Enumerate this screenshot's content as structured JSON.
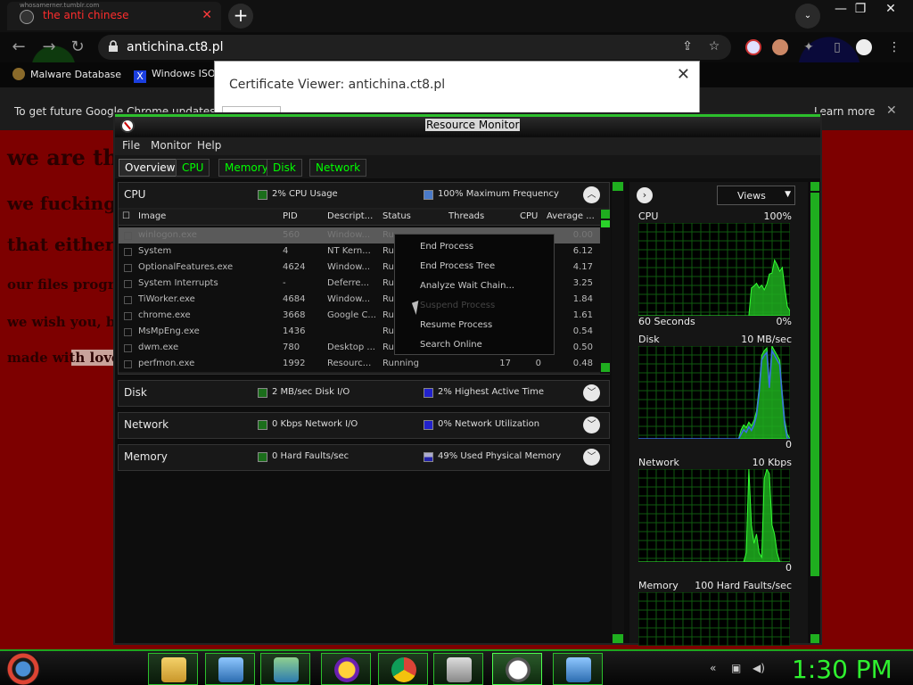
{
  "browser": {
    "tab": {
      "title": "the anti chinese",
      "url_caption": "whosamerner.tumblr.com"
    },
    "url": "antichina.ct8.pl",
    "bookmarks": [
      "Malware Database",
      "Windows ISO"
    ],
    "infobar": {
      "message": "To get future Google Chrome updates,",
      "learn_more": "Learn more"
    },
    "page_lines": [
      "we are th",
      "we fucking",
      "that either",
      "our files progr",
      "we wish you, b",
      "made with love"
    ],
    "cert_viewer": {
      "title": "Certificate Viewer: antichina.ct8.pl"
    }
  },
  "resmon": {
    "title": "Resource Monitor",
    "menu": [
      "File",
      "Monitor",
      "Help"
    ],
    "tabs": [
      "Overview",
      "CPU",
      "Memory",
      "Disk",
      "Network"
    ],
    "cpu": {
      "name": "CPU",
      "usage": "2% CPU Usage",
      "freq": "100% Maximum Frequency",
      "columns": [
        "Image",
        "PID",
        "Descript...",
        "Status",
        "Threads",
        "CPU",
        "Average ..."
      ],
      "rows": [
        {
          "image": "winlogon.exe",
          "pid": "560",
          "desc": "Window...",
          "status": "Ru...",
          "threads": "",
          "cpu": "",
          "avg": "0.00"
        },
        {
          "image": "System",
          "pid": "4",
          "desc": "NT Kern...",
          "status": "Ru...",
          "threads": "",
          "cpu": "",
          "avg": "6.12"
        },
        {
          "image": "OptionalFeatures.exe",
          "pid": "4624",
          "desc": "Window...",
          "status": "Ru...",
          "threads": "",
          "cpu": "",
          "avg": "4.17"
        },
        {
          "image": "System Interrupts",
          "pid": "-",
          "desc": "Deferre...",
          "status": "Ru...",
          "threads": "",
          "cpu": "",
          "avg": "3.25"
        },
        {
          "image": "TiWorker.exe",
          "pid": "4684",
          "desc": "Window...",
          "status": "Ru...",
          "threads": "",
          "cpu": "",
          "avg": "1.84"
        },
        {
          "image": "chrome.exe",
          "pid": "3668",
          "desc": "Google C...",
          "status": "Ru...",
          "threads": "",
          "cpu": "",
          "avg": "1.61"
        },
        {
          "image": "MsMpEng.exe",
          "pid": "1436",
          "desc": "",
          "status": "Ru...",
          "threads": "",
          "cpu": "",
          "avg": "0.54"
        },
        {
          "image": "dwm.exe",
          "pid": "780",
          "desc": "Desktop ...",
          "status": "Ru...",
          "threads": "",
          "cpu": "",
          "avg": "0.50"
        },
        {
          "image": "perfmon.exe",
          "pid": "1992",
          "desc": "Resourc...",
          "status": "Running",
          "threads": "17",
          "cpu": "0",
          "avg": "0.48"
        }
      ]
    },
    "context_menu": [
      "End Process",
      "End Process Tree",
      "Analyze Wait Chain...",
      "Suspend Process",
      "Resume Process",
      "Search Online"
    ],
    "disk": {
      "name": "Disk",
      "io": "2 MB/sec Disk I/O",
      "active": "2% Highest Active Time"
    },
    "network": {
      "name": "Network",
      "io": "0 Kbps Network I/O",
      "util": "0% Network Utilization"
    },
    "memory": {
      "name": "Memory",
      "faults": "0 Hard Faults/sec",
      "used": "49% Used Physical Memory"
    },
    "right": {
      "views": "Views",
      "graphs": [
        {
          "title": "CPU",
          "max": "100%",
          "foot": "60 Seconds",
          "zero": "0%",
          "levels": [
            0,
            0,
            0,
            0,
            0,
            0,
            0,
            0,
            0,
            0,
            0,
            0,
            0,
            0,
            0,
            0,
            0,
            0,
            0,
            0,
            0,
            0,
            0,
            0,
            0,
            0,
            0,
            0,
            0,
            0,
            0,
            0,
            0,
            0,
            0,
            0,
            0,
            0,
            0,
            0,
            0,
            0,
            0,
            0,
            0.3,
            0.32,
            0.35,
            0.3,
            0.33,
            0.28,
            0.34,
            0.45,
            0.46,
            0.6,
            0.55,
            0.48,
            0.52,
            0.3,
            0.1,
            0.05
          ]
        },
        {
          "title": "Disk",
          "max": "10 MB/sec",
          "foot": "",
          "zero": "0",
          "levels": [
            0,
            0,
            0,
            0,
            0,
            0,
            0,
            0,
            0,
            0,
            0,
            0,
            0,
            0,
            0,
            0,
            0,
            0,
            0,
            0,
            0,
            0,
            0,
            0,
            0,
            0,
            0,
            0,
            0,
            0,
            0,
            0,
            0,
            0,
            0,
            0,
            0,
            0,
            0,
            0,
            0.1,
            0.15,
            0.12,
            0.18,
            0.14,
            0.2,
            0.3,
            0.55,
            0.9,
            0.95,
            0.98,
            0.6,
            1.0,
            0.95,
            0.9,
            0.85,
            0.5,
            0.2,
            0.05,
            0.0
          ]
        },
        {
          "title": "Network",
          "max": "10 Kbps",
          "foot": "",
          "zero": "0",
          "levels": [
            0,
            0,
            0,
            0,
            0,
            0,
            0,
            0,
            0,
            0,
            0,
            0,
            0,
            0,
            0,
            0,
            0,
            0,
            0,
            0,
            0,
            0,
            0,
            0,
            0,
            0,
            0,
            0,
            0,
            0,
            0,
            0,
            0,
            0,
            0,
            0,
            0,
            0,
            0,
            0,
            0,
            0,
            0.1,
            1.0,
            0.4,
            0.2,
            0.3,
            0.1,
            0.05,
            0.9,
            1.0,
            0.95,
            0.4,
            0.3,
            0.1,
            0,
            0,
            0,
            0,
            0
          ]
        },
        {
          "title": "Memory",
          "max": "100 Hard Faults/sec",
          "foot": "",
          "zero": "",
          "levels": []
        }
      ]
    }
  },
  "taskbar": {
    "clock": "1:30 PM"
  },
  "colors": {
    "accent_green": "#1fae1f",
    "page_red": "#7d0000",
    "tab_red": "#ff2d2d"
  }
}
